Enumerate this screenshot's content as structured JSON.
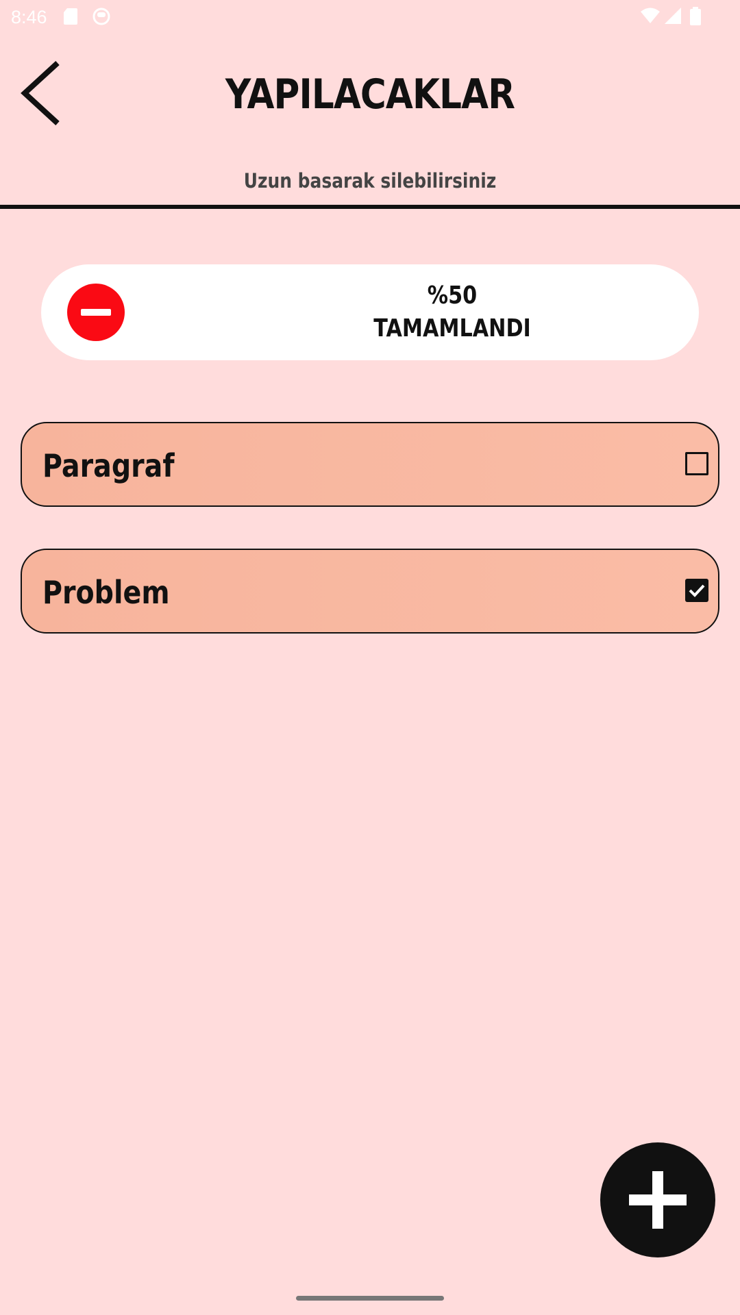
{
  "status_bar": {
    "time": "8:46",
    "icons": [
      "sd-card-icon",
      "app-notification-icon",
      "wifi-icon",
      "signal-icon",
      "battery-icon"
    ]
  },
  "header": {
    "back_icon": "chevron-left-icon",
    "title": "YAPILACAKLAR",
    "subtitle": "Uzun basarak silebilirsiniz"
  },
  "progress": {
    "percent_text": "%50",
    "status_text": "TAMAMLANDI",
    "percent_value": 50,
    "delete_icon": "minus-circle-icon"
  },
  "tasks": [
    {
      "label": "Paragraf",
      "checked": false
    },
    {
      "label": "Problem",
      "checked": true
    }
  ],
  "fab": {
    "icon": "plus-icon"
  },
  "colors": {
    "background": "#FFDCDC",
    "card": "#FFFFFF",
    "task_fill": "#F8B8A0",
    "accent_red": "#FA0A14",
    "dark": "#111111"
  }
}
